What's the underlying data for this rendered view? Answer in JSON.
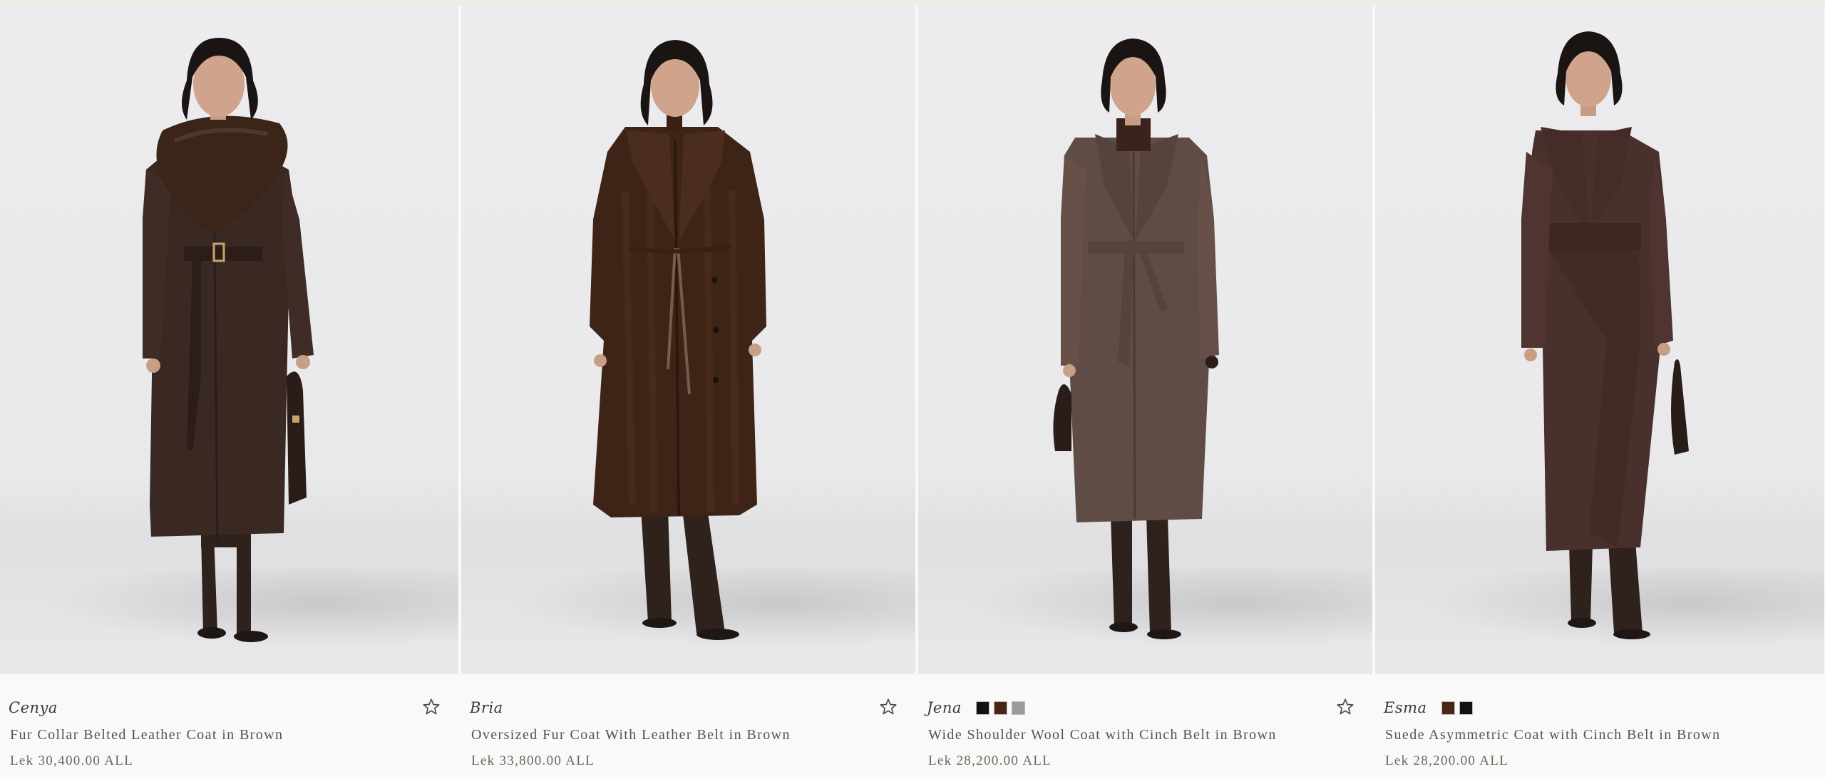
{
  "products": [
    {
      "collection": "Cenya",
      "name": "Fur Collar Belted Leather Coat in Brown",
      "price": "Lek 30,400.00 ALL",
      "swatches": [],
      "coat_color": "#3a2823",
      "collar_color": "#3b2519",
      "pants_color": "#2f211c"
    },
    {
      "collection": "Bria",
      "name": "Oversized Fur Coat With Leather Belt in Brown",
      "price": "Lek 33,800.00 ALL",
      "swatches": [],
      "coat_color": "#3e2417",
      "collar_color": "#4a2d1e",
      "pants_color": "#2f211c"
    },
    {
      "collection": "Jena",
      "name": "Wide Shoulder Wool Coat with Cinch Belt in Brown",
      "price": "Lek 28,200.00 ALL",
      "swatches": [
        "#111112",
        "#4a2416",
        "#9c9a98"
      ],
      "coat_color": "#5f4c44",
      "collar_color": "#55433c",
      "pants_color": "#2f211c"
    },
    {
      "collection": "Esma",
      "name": "Suede Asymmetric Coat with Cinch Belt in Brown",
      "price": "Lek 28,200.00 ALL",
      "swatches": [
        "#4a2416",
        "#111112"
      ],
      "coat_color": "#4a302c",
      "collar_color": "#452c28",
      "pants_color": "#2f211c"
    }
  ],
  "icons": {
    "favorite": "star-outline-icon"
  }
}
